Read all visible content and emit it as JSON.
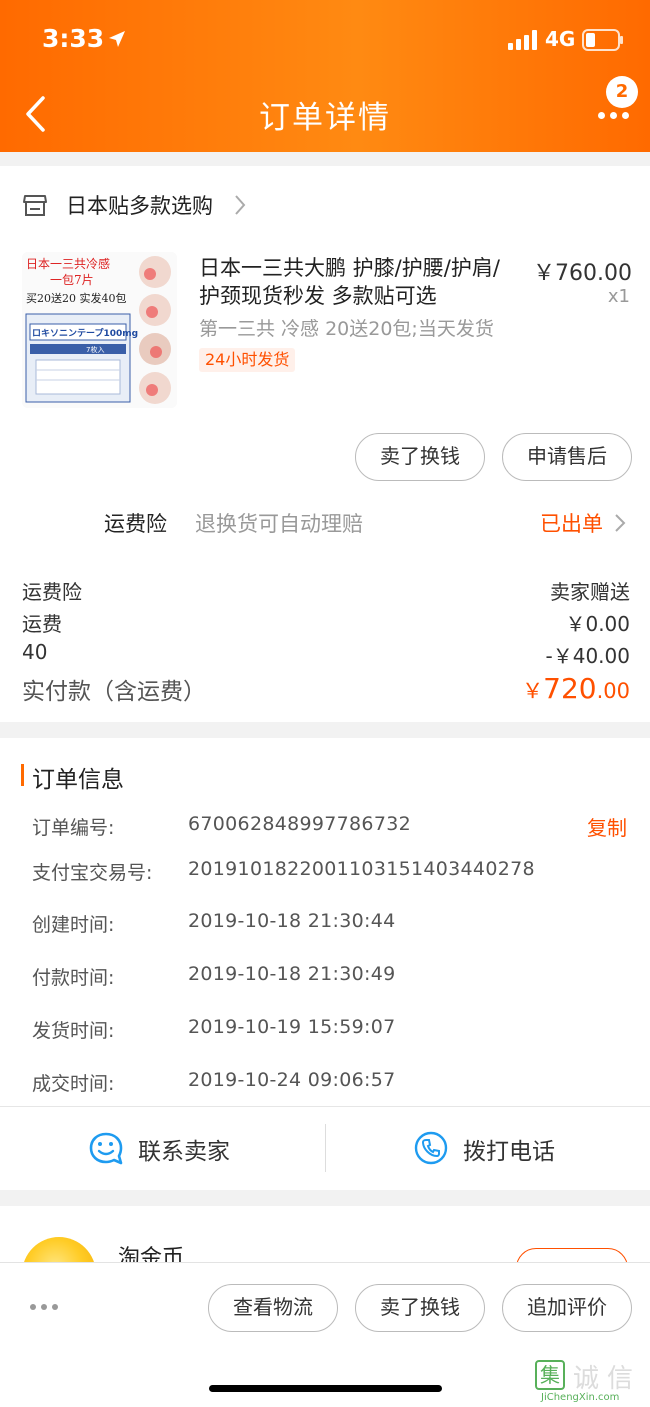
{
  "status_bar": {
    "time": "3:33",
    "network": "4G"
  },
  "header": {
    "title": "订单详情",
    "notification_count": "2"
  },
  "shop": {
    "name": "日本贴多款选购"
  },
  "product": {
    "title": "日本一三共大鹏 护膝/护腰/护肩/护颈现货秒发 多款贴可选",
    "price": "￥760.00",
    "quantity": "x1",
    "sku": "第一三共 冷感 20送20包;当天发货",
    "tag": "24小时发货",
    "image_text": {
      "line1": "日本一三共冷感",
      "line2": "一包7片",
      "line3": "买20送20  实发40包",
      "box_label": "ロキソニンテープ100mg",
      "box_sub": "7枚入"
    }
  },
  "item_actions": {
    "sell_button": "卖了换钱",
    "after_sale_button": "申请售后"
  },
  "insurance": {
    "label": "运费险",
    "description": "退换货可自动理赔",
    "status": "已出单"
  },
  "fees": {
    "rows": [
      {
        "label": "运费险",
        "value": "卖家赠送"
      },
      {
        "label": "运费",
        "value": "￥0.00"
      },
      {
        "label": "40",
        "value": "-￥40.00"
      }
    ],
    "total_label": "实付款（含运费）",
    "total_currency": "￥",
    "total_integer": "720",
    "total_decimal": ".00"
  },
  "order_info": {
    "title": "订单信息",
    "copy_label": "复制",
    "rows": [
      {
        "key": "订单编号:",
        "value": "670062848997786732"
      },
      {
        "key": "支付宝交易号:",
        "value": "2019101822001103151403440278"
      },
      {
        "key": "创建时间:",
        "value": "2019-10-18 21:30:44"
      },
      {
        "key": "付款时间:",
        "value": "2019-10-18 21:30:49"
      },
      {
        "key": "发货时间:",
        "value": "2019-10-19 15:59:07"
      },
      {
        "key": "成交时间:",
        "value": "2019-10-24 09:06:57"
      }
    ]
  },
  "contact": {
    "seller_label": "联系卖家",
    "phone_label": "拨打电话"
  },
  "coin": {
    "title": "淘金币"
  },
  "bottom_bar": {
    "logistics": "查看物流",
    "sell": "卖了换钱",
    "review": "追加评价"
  },
  "watermark": {
    "chars": [
      "集",
      "诚",
      "信"
    ],
    "text": "JiChengXin.com"
  },
  "colors": {
    "accent": "#ff6a00",
    "price_red": "#ff5000",
    "watermark_green": "#58b05a"
  },
  "icons": [
    "location-arrow-icon",
    "signal-icon",
    "battery-icon",
    "back-arrow-icon",
    "more-dots-icon",
    "shop-icon",
    "chevron-right-icon",
    "chat-bubble-icon",
    "phone-icon",
    "coin-icon"
  ]
}
